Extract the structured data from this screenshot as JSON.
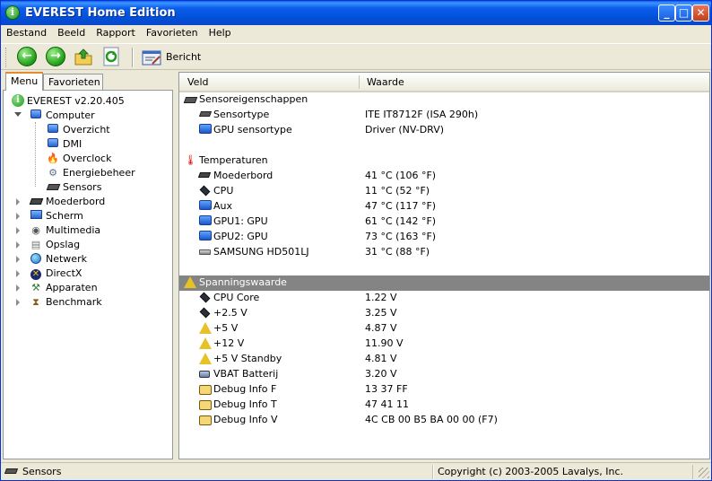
{
  "window": {
    "title": "EVEREST Home Edition"
  },
  "menubar": [
    "Bestand",
    "Beeld",
    "Rapport",
    "Favorieten",
    "Help"
  ],
  "toolbar": {
    "report_label": "Bericht"
  },
  "tabs": {
    "menu": "Menu",
    "favorites": "Favorieten"
  },
  "tree": {
    "root": "EVEREST v2.20.405",
    "computer": "Computer",
    "computer_children": [
      "Overzicht",
      "DMI",
      "Overclock",
      "Energiebeheer",
      "Sensors"
    ],
    "top_items": [
      "Moederbord",
      "Scherm",
      "Multimedia",
      "Opslag",
      "Netwerk",
      "DirectX",
      "Apparaten",
      "Benchmark"
    ]
  },
  "columns": {
    "field": "Veld",
    "value": "Waarde"
  },
  "sections": {
    "sensor_props": {
      "title": "Sensoreigenschappen",
      "rows": [
        {
          "field": "Sensortype",
          "value": "ITE IT8712F  (ISA 290h)"
        },
        {
          "field": "GPU sensortype",
          "value": "Driver  (NV-DRV)"
        }
      ]
    },
    "temperatures": {
      "title": "Temperaturen",
      "rows": [
        {
          "field": "Moederbord",
          "value": "41 °C  (106 °F)"
        },
        {
          "field": "CPU",
          "value": "11 °C  (52 °F)"
        },
        {
          "field": "Aux",
          "value": "47 °C  (117 °F)"
        },
        {
          "field": "GPU1: GPU",
          "value": "61 °C  (142 °F)"
        },
        {
          "field": "GPU2: GPU",
          "value": "73 °C  (163 °F)"
        },
        {
          "field": "SAMSUNG HD501LJ",
          "value": "31 °C  (88 °F)"
        }
      ]
    },
    "voltages": {
      "title": "Spanningswaarde",
      "rows": [
        {
          "field": "CPU Core",
          "value": "1.22 V"
        },
        {
          "field": "+2.5 V",
          "value": "3.25 V"
        },
        {
          "field": "+5 V",
          "value": "4.87 V"
        },
        {
          "field": "+12 V",
          "value": "11.90 V"
        },
        {
          "field": "+5 V Standby",
          "value": "4.81 V"
        },
        {
          "field": "VBAT Batterij",
          "value": "3.20 V"
        },
        {
          "field": "Debug Info F",
          "value": "13 37 FF"
        },
        {
          "field": "Debug Info T",
          "value": "47 41 11"
        },
        {
          "field": "Debug Info V",
          "value": "4C CB 00 B5 BA 00 00  (F7)"
        }
      ]
    }
  },
  "statusbar": {
    "left": "Sensors",
    "right": "Copyright (c) 2003-2005 Lavalys, Inc."
  }
}
